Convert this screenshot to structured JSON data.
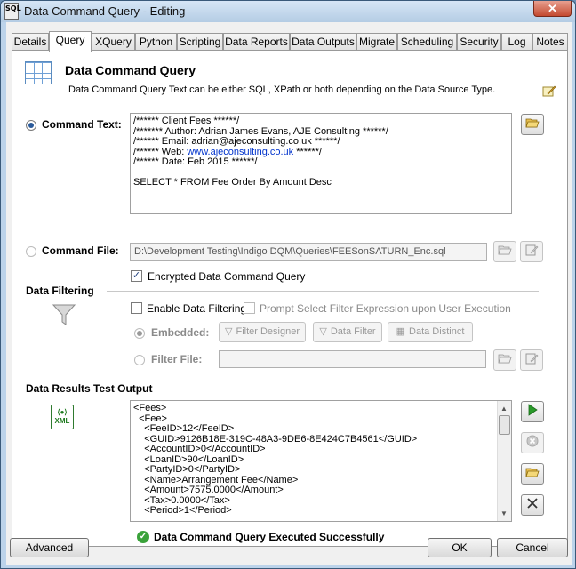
{
  "window": {
    "title": "Data Command Query - Editing",
    "app_icon_text": "SQL",
    "close_glyph": "✕"
  },
  "tabs": [
    "Details",
    "Query",
    "XQuery",
    "Python",
    "Scripting",
    "Data Reports",
    "Data Outputs",
    "Migrate",
    "Scheduling",
    "Security",
    "Log",
    "Notes"
  ],
  "active_tab": "Query",
  "header": {
    "title": "Data Command Query",
    "description": "Data Command Query Text can be either SQL, XPath or both depending on the Data Source Type."
  },
  "command_text": {
    "label": "Command Text:",
    "lines": [
      "/****** Client Fees ******/",
      "/******* Author: Adrian James Evans, AJE Consulting ******/",
      "/****** Email: adrian@ajeconsulting.co.uk ******/",
      "/****** Web: ",
      "www.ajeconsulting.co.uk",
      " ******/",
      "/****** Date: Feb 2015 ******/",
      "",
      "SELECT * FROM Fee Order By Amount Desc"
    ]
  },
  "command_file": {
    "label": "Command File:",
    "path": "D:\\Development Testing\\Indigo DQM\\Queries\\FEESonSATURN_Enc.sql"
  },
  "encrypted_label": "Encrypted Data Command Query",
  "filtering": {
    "section_title": "Data Filtering",
    "enable_label": "Enable Data Filtering",
    "prompt_label": "Prompt Select Filter Expression upon User Execution",
    "embedded_label": "Embedded:",
    "filter_designer": "Filter Designer",
    "data_filter": "Data Filter",
    "data_distinct": "Data Distinct",
    "filter_file_label": "Filter File:"
  },
  "results": {
    "section_title": "Data Results Test Output",
    "xml_icon_text": "XML",
    "lines": [
      "<Fees>",
      "  <Fee>",
      "    <FeeID>12</FeeID>",
      "    <GUID>9126B18E-319C-48A3-9DE6-8E424C7B4561</GUID>",
      "    <AccountID>0</AccountID>",
      "    <LoanID>90</LoanID>",
      "    <PartyID>0</PartyID>",
      "    <Name>Arrangement Fee</Name>",
      "    <Amount>7575.0000</Amount>",
      "    <Tax>0.0000</Tax>",
      "    <Period>1</Period>"
    ],
    "status": "Data Command Query Executed Successfully"
  },
  "footer": {
    "advanced": "Advanced",
    "ok": "OK",
    "cancel": "Cancel"
  },
  "colors": {
    "accent": "#2a5a9a",
    "success": "#3aa23a",
    "run_green": "#2a9a2a"
  }
}
